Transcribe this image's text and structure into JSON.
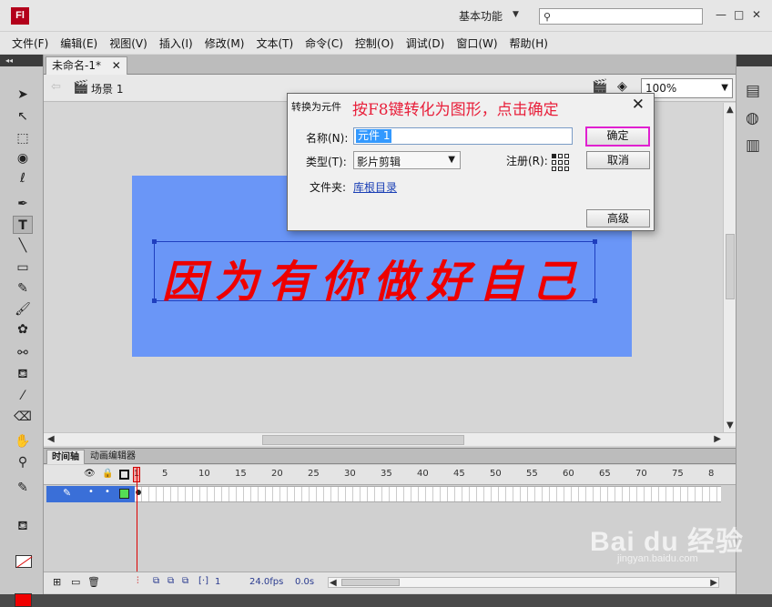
{
  "app": {
    "logo_text": "Fl",
    "workspace": "基本功能",
    "window_controls": [
      "—",
      "□",
      "✕"
    ]
  },
  "menu": [
    "文件(F)",
    "编辑(E)",
    "视图(V)",
    "插入(I)",
    "修改(M)",
    "文本(T)",
    "命令(C)",
    "控制(O)",
    "调试(D)",
    "窗口(W)",
    "帮助(H)"
  ],
  "document": {
    "tab_label": "未命名-1*",
    "tab_close": "✕",
    "scene_label": "场景 1",
    "zoom": "100%",
    "stage_text": "因为有你做好自己",
    "stage_color": "#6a96f7",
    "text_color": "#ee0000"
  },
  "dialog": {
    "title": "转换为元件",
    "annotation": "按F8键转化为图形，点击确定",
    "close": "✕",
    "name_label": "名称(N):",
    "name_value": "元件 1",
    "type_label": "类型(T):",
    "type_value": "影片剪辑",
    "registration_label": "注册(R):",
    "folder_label": "文件夹:",
    "folder_link": "库根目录",
    "ok": "确定",
    "cancel": "取消",
    "advanced": "高级"
  },
  "timeline": {
    "tabs": [
      "时间轴",
      "动画编辑器"
    ],
    "frame_numbers": [
      "1",
      "5",
      "10",
      "15",
      "20",
      "25",
      "30",
      "35",
      "40",
      "45",
      "50",
      "55",
      "60",
      "65",
      "70",
      "75",
      "8"
    ],
    "current_frame": "1",
    "fps": "24.0fps",
    "time": "0.0s"
  },
  "watermark": {
    "main": "Bai du 经验",
    "sub": "jingyan.baidu.com"
  }
}
